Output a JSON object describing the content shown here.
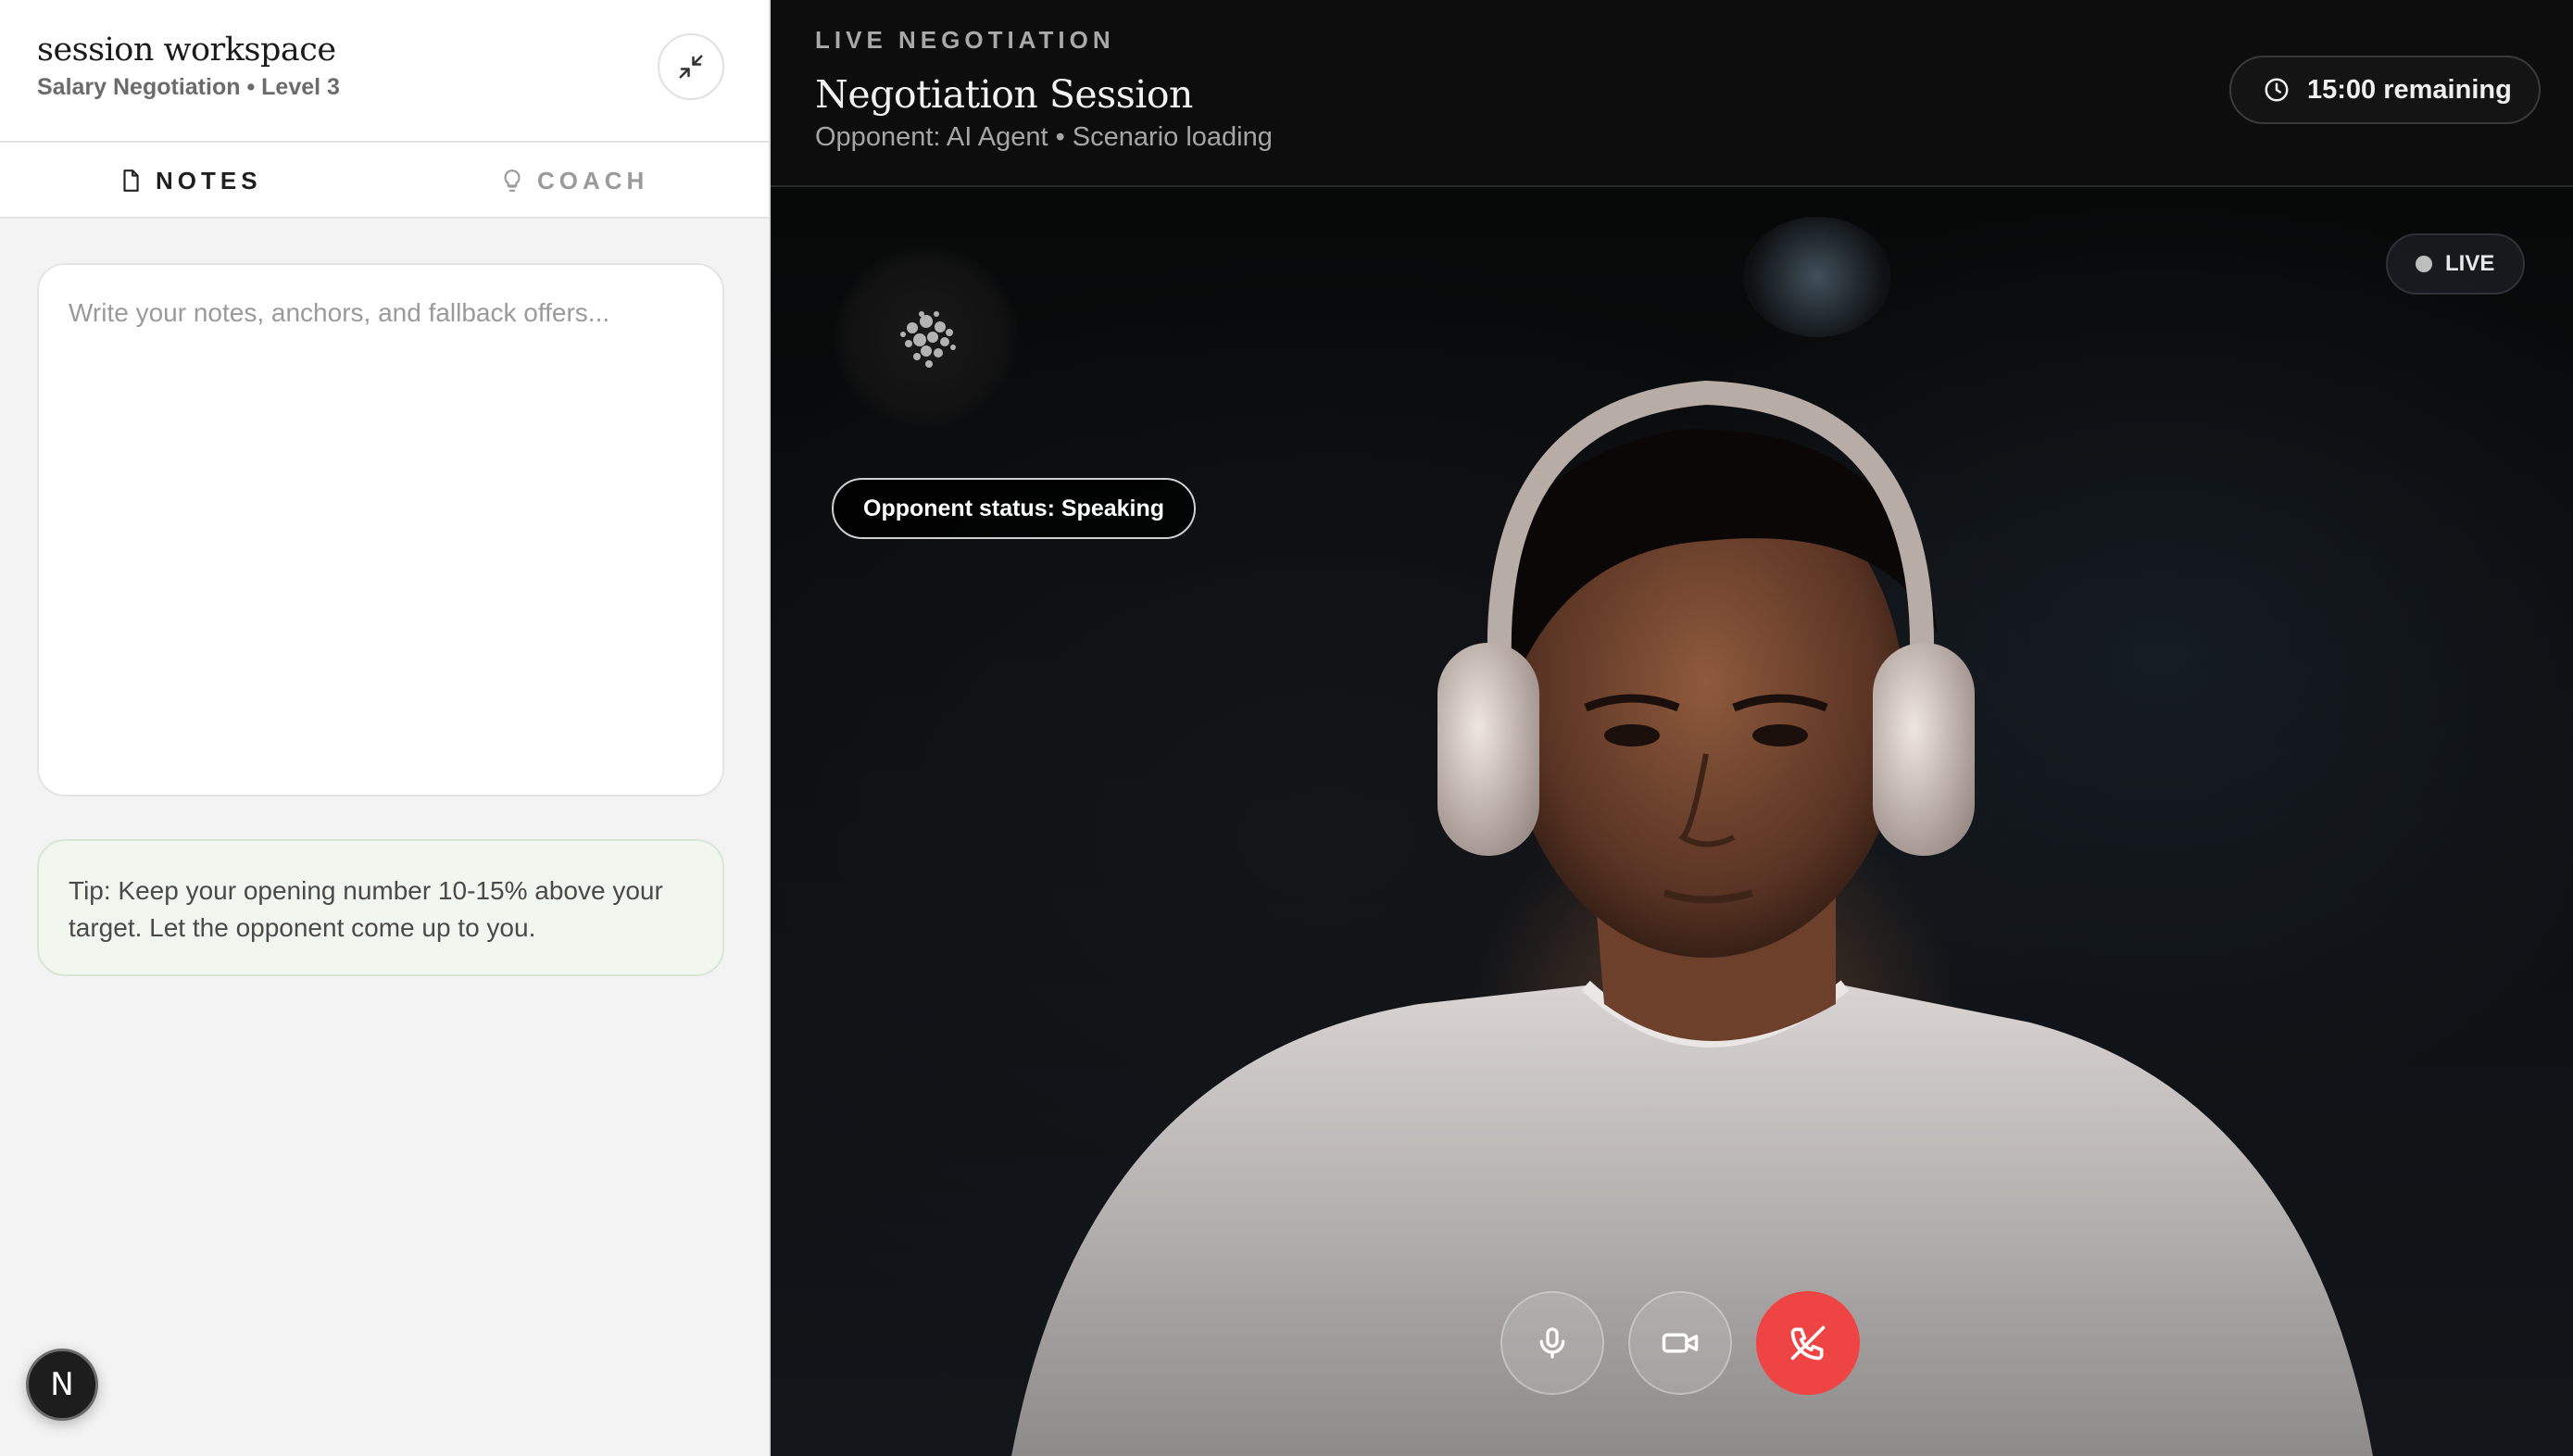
{
  "sidebar": {
    "title": "session workspace",
    "subtitle": "Salary Negotiation • Level 3",
    "tabs": [
      {
        "label": "NOTES",
        "active": true,
        "icon": "document-icon"
      },
      {
        "label": "COACH",
        "active": false,
        "icon": "lightbulb-icon"
      }
    ],
    "notes_placeholder": "Write your notes, anchors, and fallback offers...",
    "notes_value": "",
    "tip": "Tip: Keep your opening number 10-15% above your target. Let the opponent come up to you.",
    "badge_letter": "N"
  },
  "header": {
    "eyebrow": "LIVE NEGOTIATION",
    "title": "Negotiation Session",
    "subtitle": "Opponent: AI Agent • Scenario loading",
    "timer": "15:00 remaining"
  },
  "video": {
    "opponent_status": "Opponent status: Speaking",
    "live_label": "LIVE"
  },
  "controls": [
    {
      "name": "microphone",
      "icon": "microphone-icon"
    },
    {
      "name": "camera",
      "icon": "video-camera-icon"
    },
    {
      "name": "end-call",
      "icon": "phone-hangup-icon",
      "color": "#ef4444"
    }
  ],
  "colors": {
    "accent_end_call": "#ef4444",
    "tip_background": "#f1f6ef",
    "dark_background": "#0d0d0d"
  }
}
